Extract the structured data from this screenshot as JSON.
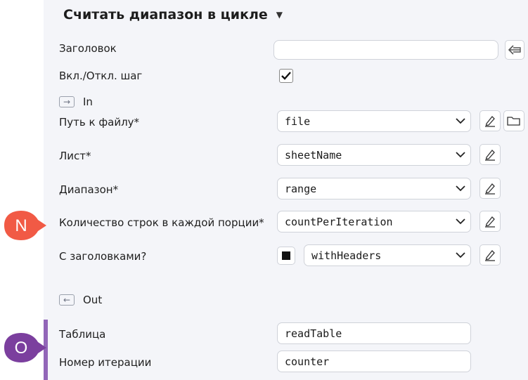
{
  "header": {
    "title": "Считать диапазон в цикле"
  },
  "fields": {
    "title_label": "Заголовок",
    "title_value": "",
    "step_toggle_label": "Вкл./Откл. шаг",
    "step_enabled": true
  },
  "sections": {
    "in_label": "In",
    "out_label": "Out"
  },
  "inputs": [
    {
      "label": "Путь к файлу*",
      "value": "file"
    },
    {
      "label": "Лист*",
      "value": "sheetName"
    },
    {
      "label": "Диапазон*",
      "value": "range"
    },
    {
      "label": "Количество строк в каждой порции*",
      "value": "countPerIteration"
    },
    {
      "label": "С заголовками?",
      "value": "withHeaders"
    }
  ],
  "outputs": [
    {
      "label": "Таблица",
      "value": "readTable"
    },
    {
      "label": "Номер итерации",
      "value": "counter"
    }
  ],
  "markers": {
    "n": {
      "text": "N",
      "color": "#f15a45"
    },
    "o": {
      "text": "O",
      "color": "#7b3f9e"
    }
  },
  "colors": {
    "out_bar": "#9266b8",
    "panel_bg": "#f4f5f9"
  }
}
